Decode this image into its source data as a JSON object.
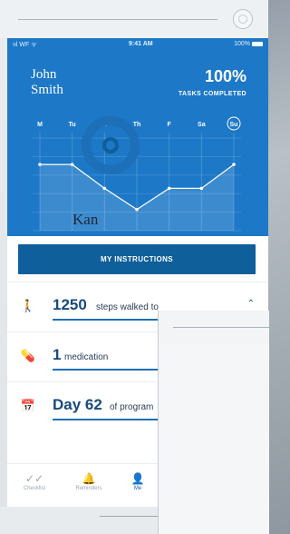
{
  "status_bar": {
    "left": "ııl WF ᯤ",
    "time": "9:41 AM",
    "battery": "100%"
  },
  "header": {
    "first_name": "John",
    "last_name": "Smith",
    "percent": "100%",
    "tasks_label": "TASKS COMPLETED"
  },
  "chart_data": {
    "type": "line",
    "categories": [
      "M",
      "Tu",
      "W",
      "Th",
      "F",
      "Sa",
      "Su"
    ],
    "values": [
      5,
      5,
      3.2,
      1.6,
      3.2,
      3.2,
      5
    ],
    "ylim": [
      0,
      7
    ],
    "highlight_category": "Su",
    "grid": true
  },
  "primary_button": {
    "label": "MY INSTRUCTIONS"
  },
  "rows": [
    {
      "icon": "walking-icon",
      "value": "1250",
      "text": "steps walked to",
      "progress": 1.0
    },
    {
      "icon": "pill-icon",
      "value": "1",
      "text": "medication",
      "progress": 1.0
    },
    {
      "icon": "calendar-icon",
      "value": "Day 62",
      "text": "of program",
      "progress": 1.0
    }
  ],
  "tabs": [
    {
      "label": "Checklist",
      "icon": "checkmarks-icon"
    },
    {
      "label": "Reminders",
      "icon": "bell-icon"
    },
    {
      "label": "Me",
      "icon": "person-icon"
    }
  ],
  "overlay": {
    "brand_text": "Kan"
  },
  "colors": {
    "accent": "#1d78c7",
    "button": "#0f5f9b",
    "text_dark": "#18497d"
  }
}
